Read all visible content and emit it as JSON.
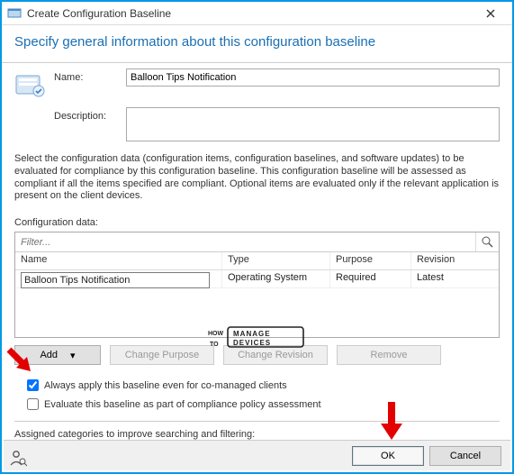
{
  "window": {
    "title": "Create Configuration Baseline"
  },
  "header": {
    "title": "Specify general information about this configuration baseline"
  },
  "form": {
    "name_label": "Name:",
    "name_value": "Balloon Tips Notification",
    "desc_label": "Description:",
    "desc_value": ""
  },
  "info_text": "Select the configuration data (configuration items, configuration baselines, and software updates) to be evaluated for compliance by this configuration baseline. This configuration baseline will be assessed as compliant if all the items specified are compliant. Optional items are evaluated only if the relevant application is present on  the client devices.",
  "config_data": {
    "label": "Configuration data:",
    "filter_placeholder": "Filter...",
    "columns": {
      "name": "Name",
      "type": "Type",
      "purpose": "Purpose",
      "revision": "Revision"
    },
    "rows": [
      {
        "name": "Balloon Tips Notification",
        "type": "Operating System",
        "purpose": "Required",
        "revision": "Latest"
      }
    ]
  },
  "buttons": {
    "add": "Add",
    "change_purpose": "Change Purpose",
    "change_revision": "Change Revision",
    "remove": "Remove"
  },
  "checkboxes": {
    "always_apply": "Always apply this baseline even for co-managed clients",
    "evaluate": "Evaluate this baseline as part of compliance policy assessment"
  },
  "categories_label": "Assigned categories to improve searching and filtering:",
  "footer": {
    "ok": "OK",
    "cancel": "Cancel"
  },
  "watermark": {
    "top": "HOW",
    "mid": "MANAGE",
    "bot": "DEVICES",
    "to": "TO"
  }
}
